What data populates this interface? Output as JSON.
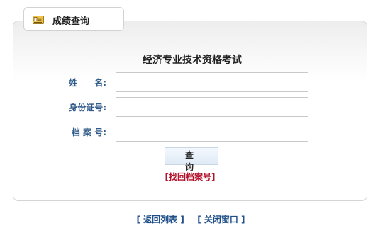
{
  "tab": {
    "title": "成绩查询",
    "icon": "id-card-icon"
  },
  "form": {
    "title": "经济专业技术资格考试",
    "fields": [
      {
        "label": "姓　　名:",
        "value": "",
        "placeholder": ""
      },
      {
        "label": "身份证号:",
        "value": "",
        "placeholder": ""
      },
      {
        "label": "档 案 号:",
        "value": "",
        "placeholder": ""
      }
    ],
    "query_button": "查 询",
    "find_link": "[找回档案号]"
  },
  "footer": {
    "back_link": "[ 返回列表 ]",
    "close_link": "[ 关闭窗口 ]"
  },
  "colors": {
    "label": "#2f5b8a",
    "find_link": "#b3122c",
    "footer_link": "#1f4f89",
    "border": "#d5d5d5"
  }
}
